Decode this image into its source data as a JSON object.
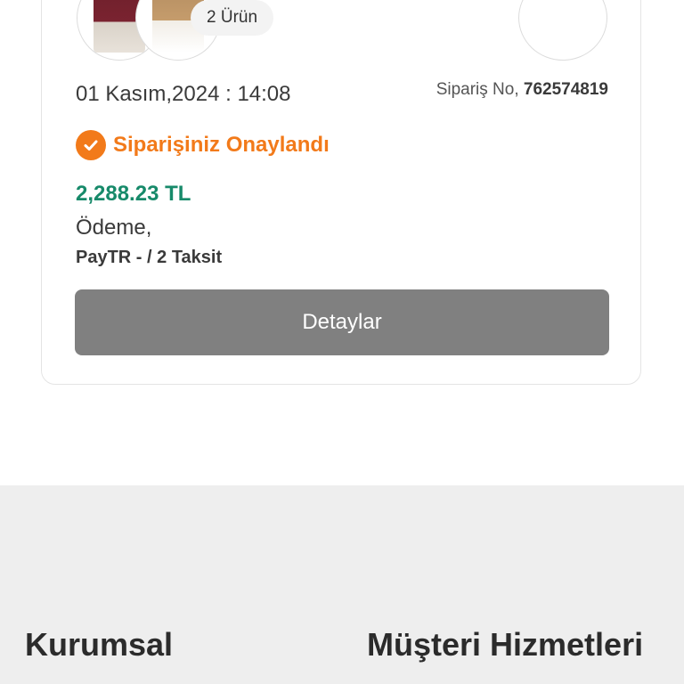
{
  "order": {
    "items_count_label": "2 Ürün",
    "date_time": "01 Kasım,2024 : 14:08",
    "order_no_label": "Sipariş No, ",
    "order_no_value": "762574819",
    "status": "Siparişiniz Onaylandı",
    "status_icon": "check-circle-icon",
    "total": "2,288.23 TL",
    "payment_label": "Ödeme,",
    "payment_method": "PayTR - / 2 Taksit",
    "details_button": "Detaylar",
    "product_images": [
      "burgundy-blazer-product-image",
      "camel-blazer-product-image"
    ]
  },
  "footer": {
    "corporate_heading": "Kurumsal",
    "support_heading": "Müşteri Hizmetleri"
  },
  "colors": {
    "accent_orange": "#f27a1a",
    "price_green": "#178a6a",
    "button_gray": "#808080",
    "footer_bg": "#eeeeee"
  }
}
